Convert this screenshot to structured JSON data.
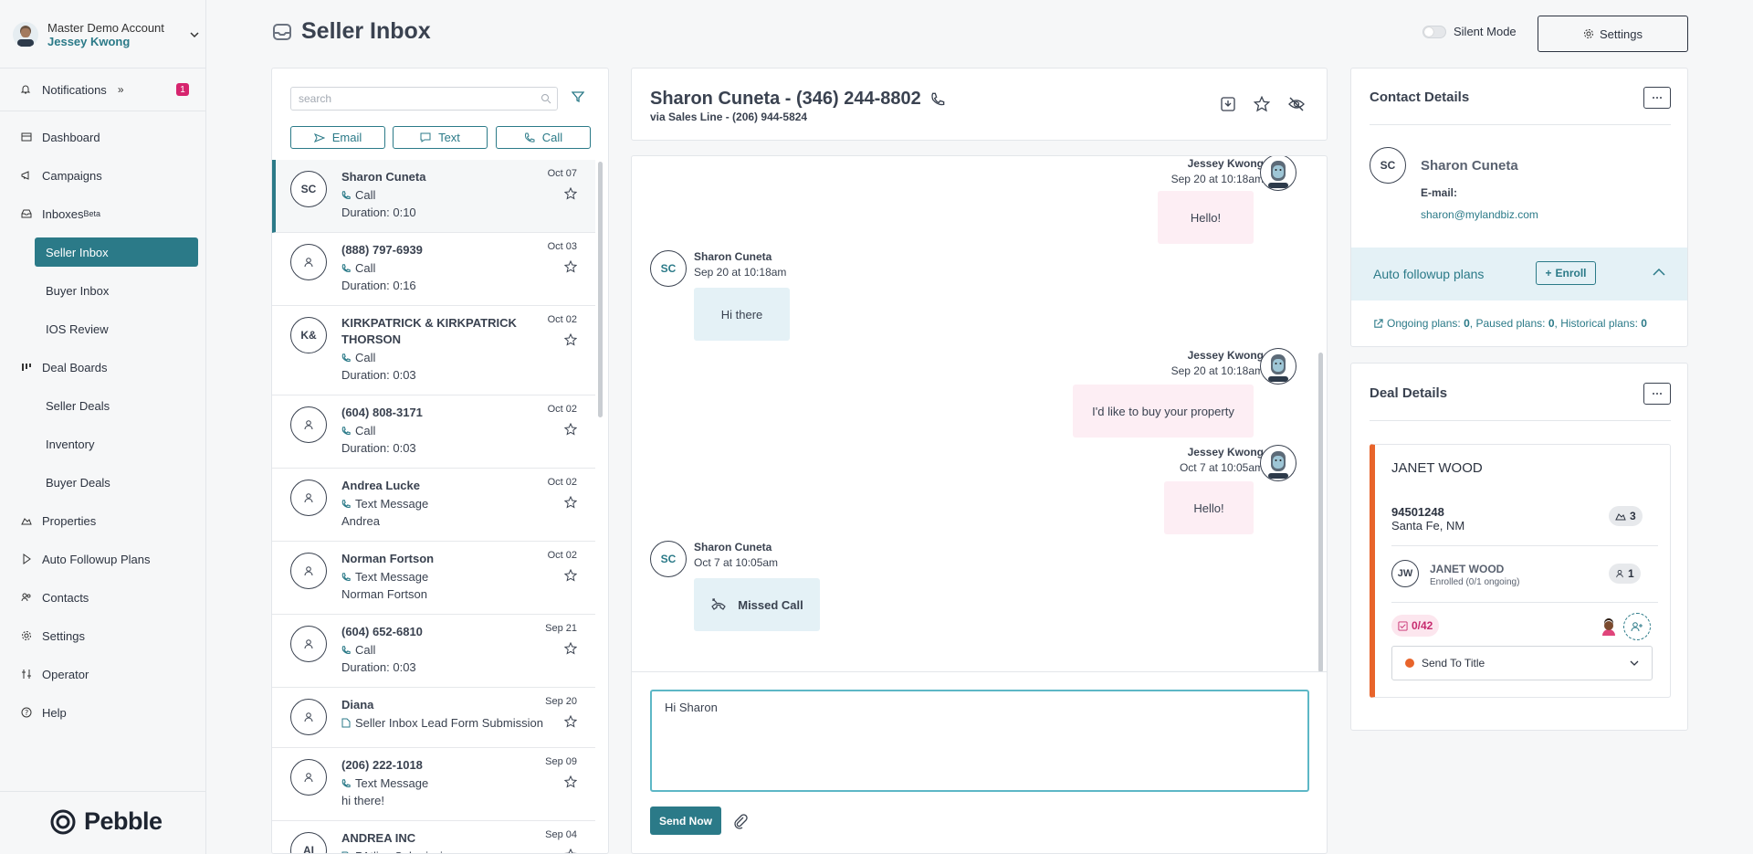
{
  "sidebar": {
    "account_name": "Master Demo Account",
    "account_user": "Jessey Kwong",
    "notifications": {
      "label": "Notifications",
      "expand": "»",
      "count": "1"
    },
    "items": [
      {
        "label": "Dashboard",
        "icon": "dashboard-icon"
      },
      {
        "label": "Campaigns",
        "icon": "megaphone-icon"
      },
      {
        "label": "Inboxes",
        "superscript": "Beta",
        "icon": "inbox-icon"
      },
      {
        "label": "Seller Inbox",
        "active": true
      },
      {
        "label": "Buyer Inbox"
      },
      {
        "label": "IOS Review"
      },
      {
        "label": "Deal Boards",
        "icon": "board-icon"
      },
      {
        "label": "Seller Deals"
      },
      {
        "label": "Inventory"
      },
      {
        "label": "Buyer Deals"
      },
      {
        "label": "Properties",
        "icon": "house-icon"
      },
      {
        "label": "Auto Followup Plans",
        "icon": "play-icon"
      },
      {
        "label": "Contacts",
        "icon": "people-icon"
      },
      {
        "label": "Settings",
        "icon": "gear-icon"
      },
      {
        "label": "Operator",
        "icon": "sliders-icon"
      },
      {
        "label": "Help",
        "icon": "help-icon"
      }
    ],
    "logo_text": "Pebble"
  },
  "header": {
    "title": "Seller Inbox",
    "silent_mode_label": "Silent Mode",
    "silent_mode_on": false,
    "settings_label": "Settings"
  },
  "inbox_list": {
    "search_placeholder": "search",
    "channel_buttons": [
      "Email",
      "Text",
      "Call"
    ],
    "conversations": [
      {
        "initials": "SC",
        "name": "Sharon Cuneta",
        "type": "Call",
        "detail": "Duration: 0:10",
        "date": "Oct 07",
        "selected": true
      },
      {
        "initials": "",
        "name": "(888) 797-6939",
        "type": "Call",
        "detail": "Duration: 0:16",
        "date": "Oct 03"
      },
      {
        "initials": "K&",
        "name": "KIRKPATRICK & KIRKPATRICK THORSON",
        "type": "Call",
        "detail": "Duration: 0:03",
        "date": "Oct 02"
      },
      {
        "initials": "",
        "name": "(604) 808-3171",
        "type": "Call",
        "detail": "Duration: 0:03",
        "date": "Oct 02"
      },
      {
        "initials": "",
        "name": "Andrea Lucke",
        "type": "Text Message",
        "detail": "Andrea",
        "date": "Oct 02"
      },
      {
        "initials": "",
        "name": "Norman Fortson",
        "type": "Text Message",
        "detail": "Norman Fortson",
        "date": "Oct 02"
      },
      {
        "initials": "",
        "name": "(604) 652-6810",
        "type": "Call",
        "detail": "Duration: 0:03",
        "date": "Sep 21"
      },
      {
        "initials": "",
        "name": "Diana",
        "type": "Seller Inbox Lead Form Submission",
        "detail": "",
        "date": "Sep 20"
      },
      {
        "initials": "",
        "name": "(206) 222-1018",
        "type": "Text Message",
        "detail": "hi there!",
        "date": "Sep 09"
      },
      {
        "initials": "AI",
        "name": "ANDREA INC",
        "type": "PAtlive Submission",
        "detail": "",
        "date": "Sep 04"
      }
    ]
  },
  "conversation": {
    "title": "Sharon Cuneta - (346) 244-8802",
    "subtitle": "via Sales Line - (206) 944-5824",
    "messages": [
      {
        "sender": "Jessey Kwong",
        "time": "Sep 20 at 10:18am",
        "text": "Hello!",
        "direction": "out"
      },
      {
        "sender": "Sharon Cuneta",
        "initials": "SC",
        "time": "Sep 20 at 10:18am",
        "text": "Hi there",
        "direction": "in"
      },
      {
        "sender": "Jessey Kwong",
        "time": "Sep 20 at 10:18am",
        "text": "I'd like to buy your property",
        "direction": "out"
      },
      {
        "sender": "Jessey Kwong",
        "time": "Oct 7 at 10:05am",
        "text": "Hello!",
        "direction": "out"
      },
      {
        "sender": "Sharon Cuneta",
        "initials": "SC",
        "time": "Oct 7 at 10:05am",
        "text": "Missed Call",
        "direction": "in"
      }
    ],
    "composer_value": "Hi Sharon",
    "send_label": "Send Now"
  },
  "contact_details": {
    "title": "Contact Details",
    "initials": "SC",
    "name": "Sharon Cuneta",
    "email_label": "E-mail:",
    "email": "sharon@mylandbiz.com",
    "auto_followup_title": "Auto followup plans",
    "enroll_label": "Enroll",
    "ongoing_label": "Ongoing plans:",
    "ongoing": "0",
    "paused_label": "Paused plans:",
    "paused": "0",
    "historical_label": "Historical plans:",
    "historical": "0"
  },
  "deal_details": {
    "title": "Deal Details",
    "deal_name": "JANET WOOD",
    "parcel_id": "94501248",
    "location": "Santa Fe, NM",
    "property_count": "3",
    "contact_initials": "JW",
    "contact_name": "JANET WOOD",
    "contact_enrolled": "Enrolled (0/1 ongoing)",
    "contact_count": "1",
    "tasks": "0/42",
    "stage": "Send To Title",
    "stage_color": "#e8642b"
  },
  "colors": {
    "accent": "#2b7a88",
    "badge": "#d6246e",
    "outgoing_bubble": "#fdeef4",
    "incoming_bubble": "#e4f1f6"
  }
}
